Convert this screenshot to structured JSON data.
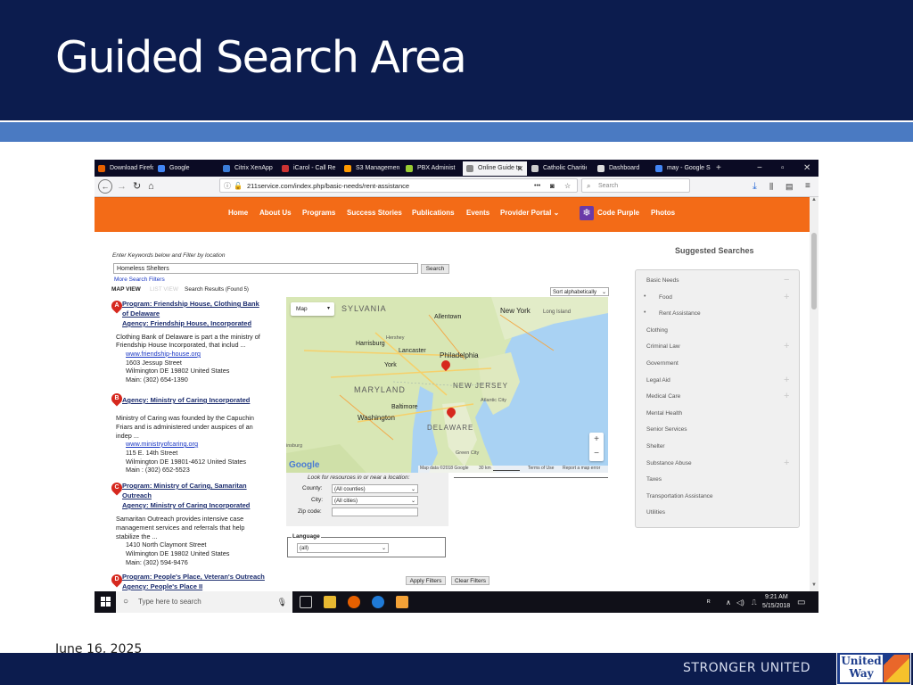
{
  "slide": {
    "title": "Guided Search Area",
    "date": "June 16, 2025",
    "footer_text": "STRONGER UNITED",
    "logo_text": "United Way"
  },
  "browser": {
    "tabs": [
      {
        "label": "Download Firefox",
        "icon_color": "#e66000"
      },
      {
        "label": "Google",
        "icon_color": "#4285f4"
      },
      {
        "label": "Citrix XenApp",
        "icon_color": "#3b7dd8"
      },
      {
        "label": "iCarol - Call Re",
        "icon_color": "#c33"
      },
      {
        "label": "S3 Management",
        "icon_color": "#f90"
      },
      {
        "label": "PBX Administ",
        "icon_color": "#9c3"
      },
      {
        "label": "Online Guide to",
        "icon_color": "#888",
        "active": true
      },
      {
        "label": "Catholic Charities",
        "icon_color": "#ccc"
      },
      {
        "label": "Dashboard",
        "icon_color": "#ddd"
      },
      {
        "label": "may - Google S",
        "icon_color": "#4285f4"
      }
    ],
    "url": "211service.com/index.php/basic-needs/rent-assistance",
    "search_placeholder": "Search",
    "more_menu": "•••"
  },
  "site": {
    "nav": [
      "Home",
      "About Us",
      "Programs",
      "Success Stories",
      "Publications",
      "Events",
      "Provider Portal",
      "Code Purple",
      "Photos"
    ],
    "keywords_label": "Enter Keywords below and Filter by location",
    "keywords_value": "Homeless Shelters",
    "search_button": "Search",
    "more_filters": "More Search Filters",
    "map_view": "MAP VIEW",
    "list_view": "LIST VIEW",
    "results_label": "Search Results",
    "results_found": "(Found 5)",
    "sort_label": "Sort alphabetically"
  },
  "results": [
    {
      "letter": "A",
      "program": "Program: Friendship House, Clothing Bank",
      "program2": "of Delaware",
      "agency": "Agency: Friendship House, Incorporated",
      "desc1": "Clothing Bank of Delaware is part a the ministry of",
      "desc2": "Friendship House Incorporated, that includ ...",
      "link": "www.friendship-house.org",
      "addr1": "1603 Jessup Street",
      "addr2": "Wilmington DE 19802 United States",
      "phone": "Main: (302) 654-1390"
    },
    {
      "letter": "B",
      "agency": "Agency: Ministry of Caring Incorporated",
      "desc1": "Ministry of Caring was founded by the Capuchin",
      "desc2": "Friars and is administered under auspices of an",
      "desc3": "indep ...",
      "link": "www.ministryofcaring.org",
      "addr1": "115 E. 14th Street",
      "addr2": "Wilmington DE 19801-4612 United States",
      "phone": "Main : (302) 652-5523"
    },
    {
      "letter": "C",
      "program": "Program: Ministry of Caring, Samaritan",
      "program2": "Outreach",
      "agency": "Agency: Ministry of Caring Incorporated",
      "desc1": "Samaritan Outreach provides intensive case",
      "desc2": "management services and referrals that help",
      "desc3": "stabilize the ...",
      "addr1": "1410 North Claymont Street",
      "addr2": "Wilmington DE 19802 United States",
      "phone": "Main: (302) 594-9476"
    },
    {
      "letter": "D",
      "program": "Program: People's Place, Veteran's Outreach",
      "agency": "Agency: People's Place II"
    }
  ],
  "map": {
    "type_label": "Map",
    "labels": [
      "SYLVANIA",
      "Allentown",
      "New York",
      "Long Island",
      "Harrisburg",
      "Hershey",
      "Lancaster",
      "Philadelphia",
      "York",
      "MARYLAND",
      "Baltimore",
      "Washington",
      "NEW JERSEY",
      "Atlantic City",
      "DELAWARE",
      "Green City",
      "insburg"
    ],
    "google": "Google",
    "attribution": "Map data ©2018 Google",
    "scale": "30 km",
    "terms": "Terms of Use",
    "report": "Report a map error",
    "zoom_in": "+",
    "zoom_out": "−"
  },
  "filters": {
    "near_label": "Look for resources in or near a location:",
    "county_label": "County:",
    "county_value": "(All counties)",
    "city_label": "City:",
    "city_value": "(All cities)",
    "zip_label": "Zip code:",
    "language_label": "Language",
    "language_value": "(all)",
    "apply": "Apply Filters",
    "clear": "Clear Filters"
  },
  "suggested": {
    "title": "Suggested Searches",
    "items": [
      {
        "label": "Basic Needs",
        "plus": true
      },
      {
        "label": "Food",
        "sub": true,
        "plus": true
      },
      {
        "label": "Rent Assistance",
        "sub": true
      },
      {
        "label": "Clothing"
      },
      {
        "label": "Criminal Law",
        "plus": true
      },
      {
        "label": "Government"
      },
      {
        "label": "Legal Aid",
        "plus": true
      },
      {
        "label": "Medical Care",
        "plus": true
      },
      {
        "label": "Mental Health"
      },
      {
        "label": "Senior Services"
      },
      {
        "label": "Shelter"
      },
      {
        "label": "Substance Abuse",
        "plus": true
      },
      {
        "label": "Taxes"
      },
      {
        "label": "Transportation Assistance"
      },
      {
        "label": "Utilities"
      }
    ]
  },
  "taskbar": {
    "search_placeholder": "Type here to search",
    "time": "9:21 AM",
    "date": "5/15/2018"
  }
}
